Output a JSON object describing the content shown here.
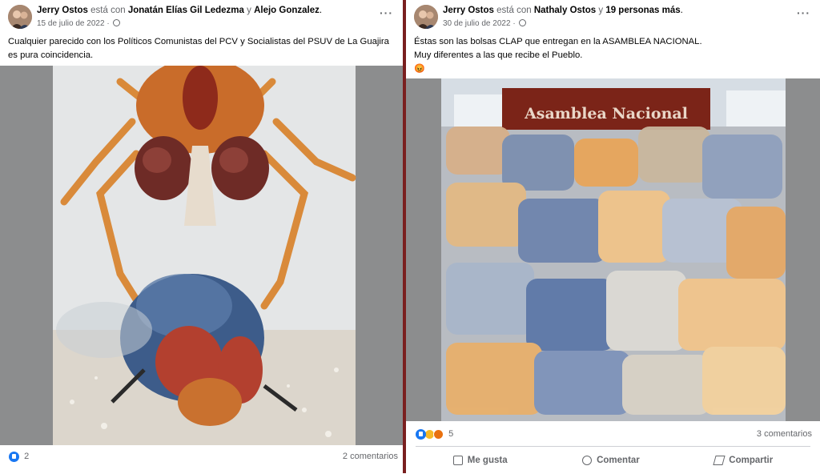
{
  "post1": {
    "author": "Jerry Ostos",
    "connector": "está con",
    "tag1": "Jonatán Elías Gil Ledezma",
    "and": "y",
    "tag2": "Alejo Gonzalez",
    "period": ".",
    "date": "15 de julio de 2022",
    "date_sep": "·",
    "text": "Cualquier parecido con los Políticos Comunistas del PCV y Socialistas del PSUV de La Guajira es pura coincidencia.",
    "reactions_count": "2",
    "comments": "2 comentarios"
  },
  "post2": {
    "author": "Jerry Ostos",
    "connector": "está con",
    "tag1": "Nathaly Ostos",
    "and": "y",
    "tag2": "19 personas más",
    "period": ".",
    "date": "30 de julio de 2022",
    "date_sep": "·",
    "text_line1": "Éstas son las bolsas CLAP que entregan en la ASAMBLEA NACIONAL.",
    "text_line2": "Muy diferentes a las que recibe el Pueblo.",
    "emoji": "😡",
    "sign_text": "Asamblea Nacional",
    "reactions_count": "5",
    "comments": "3 comentarios",
    "actions": {
      "like": "Me gusta",
      "comment": "Comentar",
      "share": "Compartir"
    }
  },
  "colors": {
    "accent": "#1877f2",
    "divider": "#7a1f1f",
    "secondary_text": "#65676b"
  }
}
